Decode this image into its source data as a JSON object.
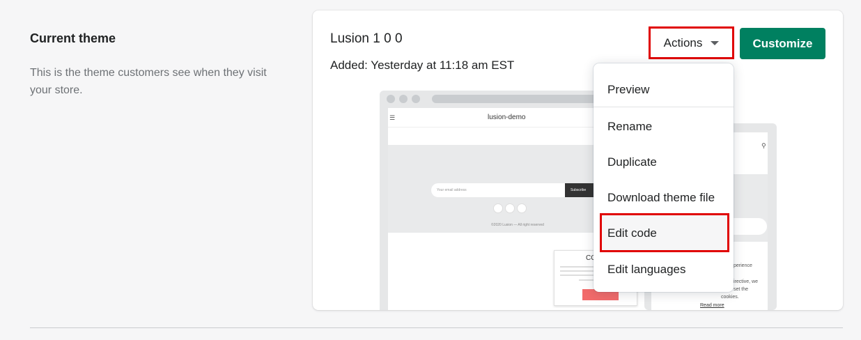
{
  "section": {
    "title": "Current theme",
    "description": "This is the theme customers see when they visit your store."
  },
  "theme": {
    "name": "Lusion 1 0 0",
    "added": "Added: Yesterday at 11:18 am EST"
  },
  "buttons": {
    "actions_label": "Actions",
    "customize_label": "Customize"
  },
  "preview": {
    "site_name": "lusion-demo",
    "email_placeholder": "Your email address",
    "subscribe_label": "Subscribe",
    "copyright": "©2020 Lusion — All right reserved",
    "cookie_title": "CO",
    "mobile_text_1": "perience",
    "mobile_text_2": "irective, we",
    "mobile_text_3": "set the",
    "mobile_text_4": "cookies.",
    "read_more": "Read more"
  },
  "actions_menu": {
    "items": [
      {
        "label": "Preview"
      },
      {
        "label": "Rename"
      },
      {
        "label": "Duplicate"
      },
      {
        "label": "Download theme file"
      },
      {
        "label": "Edit code"
      },
      {
        "label": "Edit languages"
      }
    ]
  },
  "colors": {
    "primary": "#008060",
    "highlight": "#e00000",
    "background": "#f6f6f7"
  }
}
